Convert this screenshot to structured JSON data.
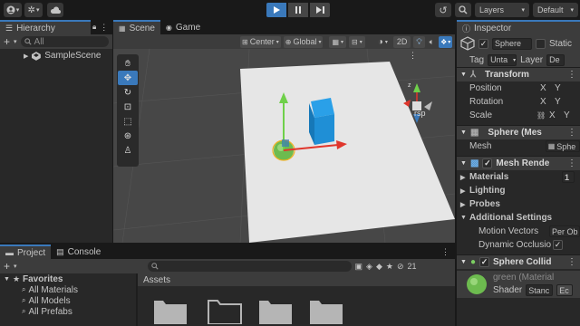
{
  "toolbar": {
    "play_state": "playing",
    "layers_label": "Layers",
    "layout_label": "Default"
  },
  "hierarchy": {
    "tab_label": "Hierarchy",
    "search_placeholder": "All",
    "scene_name": "SampleScene"
  },
  "scene": {
    "tabs": [
      {
        "label": "Scene"
      },
      {
        "label": "Game"
      }
    ],
    "pivot_label": "Center",
    "space_label": "Global",
    "mode_2d_label": "2D",
    "persp_label": "rsp",
    "tools": [
      "hand-tool",
      "move-tool",
      "rotate-tool",
      "scale-tool",
      "rect-tool",
      "transform-tool",
      "custom-tool"
    ]
  },
  "project": {
    "tabs": [
      {
        "label": "Project"
      },
      {
        "label": "Console"
      }
    ],
    "favorites_label": "Favorites",
    "favorites": [
      "All Materials",
      "All Models",
      "All Prefabs"
    ],
    "assets_label": "Assets",
    "hidden_count": "21"
  },
  "inspector": {
    "tab_label": "Inspector",
    "object_name": "Sphere",
    "static_label": "Static",
    "tag_label": "Tag",
    "tag_value": "Unta",
    "layer_label": "Layer",
    "layer_value": "De",
    "transform": {
      "title": "Transform",
      "rows": [
        {
          "label": "Position",
          "x": "X",
          "y": "Y"
        },
        {
          "label": "Rotation",
          "x": "X",
          "y": "Y"
        },
        {
          "label": "Scale",
          "x": "X",
          "y": "Y"
        }
      ]
    },
    "mesh_filter": {
      "title": "Sphere (Mes",
      "mesh_label": "Mesh",
      "mesh_value": "Sphe"
    },
    "mesh_renderer": {
      "title": "Mesh Rende",
      "sections": [
        "Materials",
        "Lighting",
        "Probes",
        "Additional Settings"
      ],
      "materials_count": "1",
      "motion_vectors_label": "Motion Vectors",
      "motion_vectors_value": "Per Ob",
      "dynamic_occlusion_label": "Dynamic Occlusio"
    },
    "collider": {
      "title": "Sphere Collid"
    },
    "material": {
      "name": "green (Material",
      "shader_label": "Shader",
      "shader_value": "Stanc",
      "edit_label": "Ec"
    }
  },
  "colors": {
    "accent": "#3a79bb",
    "panel": "#282828",
    "header": "#3c3c3c",
    "plane": "#e6e6e6",
    "cube": "#1f8fd6",
    "sphere": "#6dbb4f"
  }
}
